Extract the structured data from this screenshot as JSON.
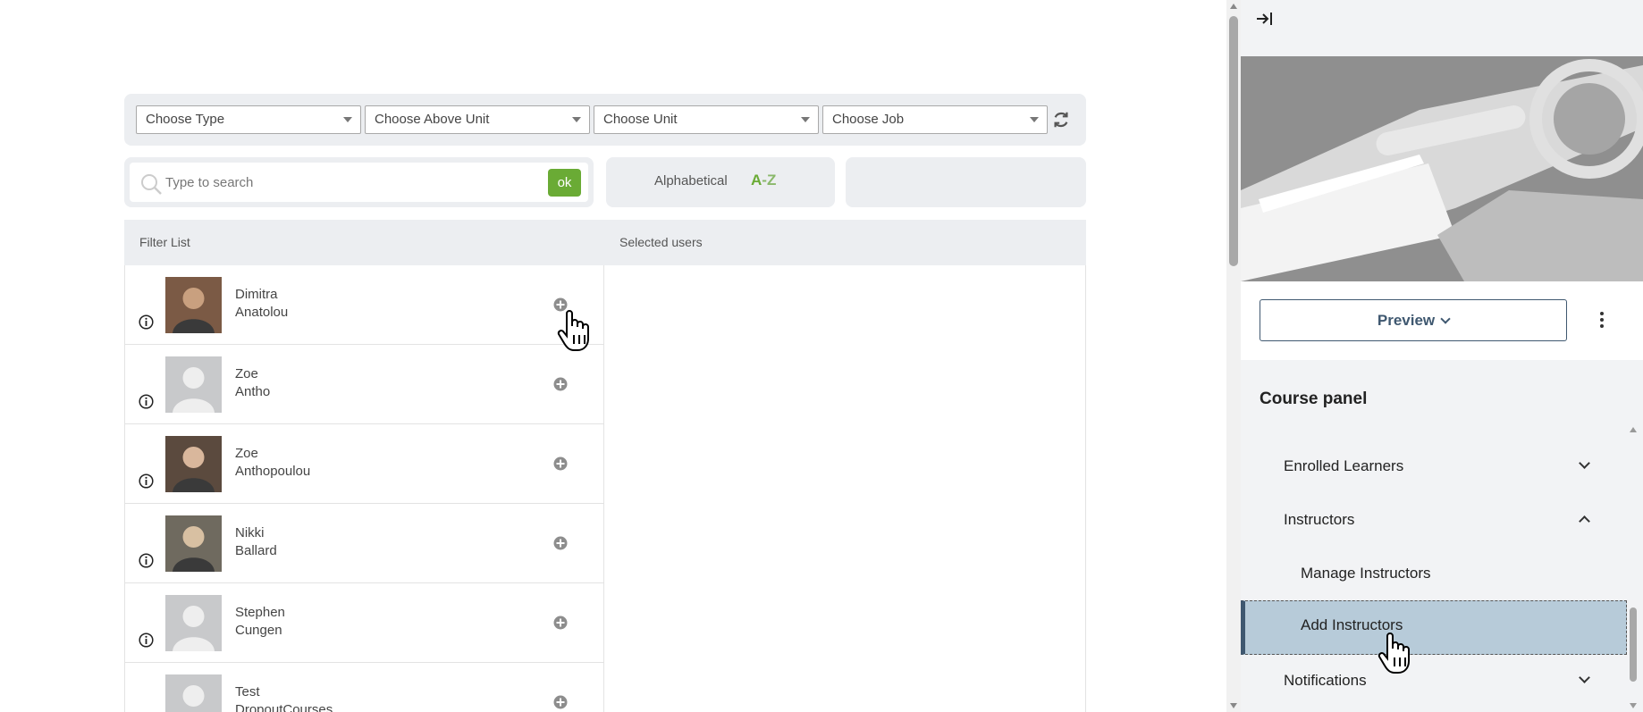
{
  "filters": {
    "type_placeholder": "Choose Type",
    "above_unit_placeholder": "Choose Above Unit",
    "unit_placeholder": "Choose Unit",
    "job_placeholder": "Choose Job"
  },
  "search": {
    "placeholder": "Type to search",
    "ok_label": "ok"
  },
  "sort": {
    "label": "Alphabetical",
    "az_a": "A",
    "az_rest": "-Z"
  },
  "list_header": {
    "filter_list": "Filter List",
    "selected_users": "Selected users"
  },
  "users": [
    {
      "first": "Dimitra",
      "last": "Anatolou",
      "photo": "photo"
    },
    {
      "first": "Zoe",
      "last": "Antho",
      "photo": "default"
    },
    {
      "first": "Zoe",
      "last": "Anthopoulou",
      "photo": "photo"
    },
    {
      "first": "Nikki",
      "last": "Ballard",
      "photo": "photo"
    },
    {
      "first": "Stephen",
      "last": "Cungen",
      "photo": "default"
    },
    {
      "first": "Test",
      "last": "DropoutCourses",
      "photo": "default"
    }
  ],
  "side": {
    "preview_label": "Preview",
    "course_panel_title": "Course panel",
    "menu": {
      "enrolled": "Enrolled Learners",
      "instructors": "Instructors",
      "manage_instructors": "Manage Instructors",
      "add_instructors": "Add Instructors",
      "notifications": "Notifications"
    }
  },
  "colors": {
    "accent_green": "#6aab35",
    "nav_blue": "#3f5870",
    "active_bg": "#b7cbd9"
  }
}
